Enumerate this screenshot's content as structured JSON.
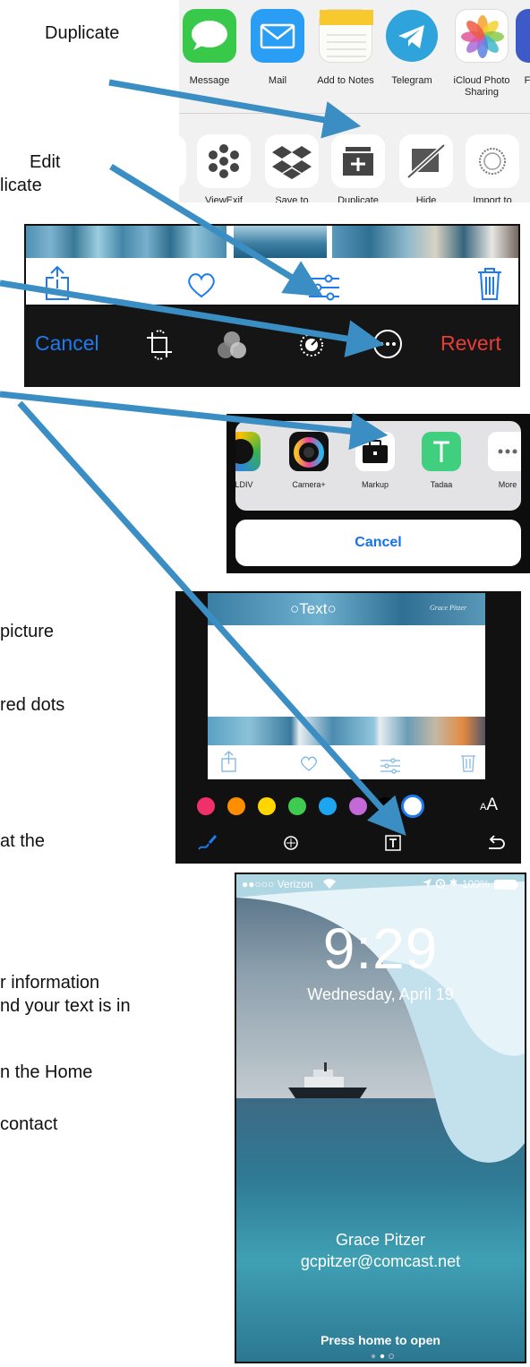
{
  "notes": [
    "Duplicate",
    "Edit",
    "licate",
    "picture",
    "red dots",
    "at the",
    "r information",
    "nd your text is in",
    "n the Home",
    "contact"
  ],
  "share_sheet": {
    "apps": [
      "Message",
      "Mail",
      "Add to Notes",
      "Telegram",
      "iCloud Photo\nSharing",
      "F"
    ],
    "actions": [
      "ViewExif",
      "Save to",
      "Duplicate",
      "Hide",
      "Import to"
    ]
  },
  "edit_bar": {
    "cancel": "Cancel",
    "revert": "Revert"
  },
  "more_sheet": {
    "apps": [
      "OLDIV",
      "Camera+",
      "Markup",
      "Tadaa",
      "More"
    ],
    "cancel": "Cancel"
  },
  "markup": {
    "text_box": "Text",
    "watermark": "Grace Pitzer",
    "colors": [
      "#f0306b",
      "#ff8f00",
      "#ffd600",
      "#3ecb4f",
      "#1ea5f2",
      "#c46ad8",
      "#000000",
      "#ffffff"
    ],
    "font_size_glyph": "AA"
  },
  "lock_screen": {
    "carrier": "●●○○○ Verizon",
    "battery": "100%",
    "time": "9:29",
    "date": "Wednesday, April 19",
    "owner_name": "Grace Pitzer",
    "owner_email": "gcpitzer@comcast.net",
    "unlock_hint": "Press home to open"
  },
  "colors": {
    "ios_blue": "#1d7bf0",
    "ios_red": "#e83e35",
    "arrow_blue": "#3a8ec3"
  }
}
